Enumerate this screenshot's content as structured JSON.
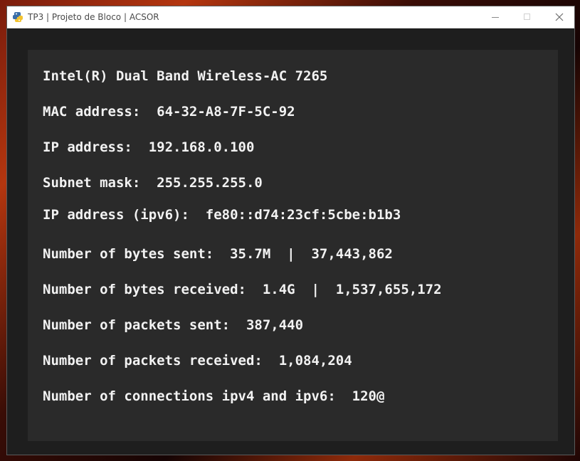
{
  "window": {
    "title": "TP3 | Projeto de Bloco | ACSOR",
    "icons": {
      "app": "python-snake-icon",
      "minimize": "minimize-icon",
      "maximize": "maximize-icon",
      "close": "close-icon"
    }
  },
  "network_info": {
    "adapter_name": "Intel(R) Dual Band Wireless-AC 7265",
    "mac_address": "MAC address:  64-32-A8-7F-5C-92",
    "ip_address": "IP address:  192.168.0.100",
    "subnet_mask": "Subnet mask:  255.255.255.0",
    "ipv6_address": "IP address (ipv6):  fe80::d74:23cf:5cbe:b1b3",
    "bytes_sent": "Number of bytes sent:  35.7M  |  37,443,862",
    "bytes_received": "Number of bytes received:  1.4G  |  1,537,655,172",
    "packets_sent": "Number of packets sent:  387,440",
    "packets_received": "Number of packets received:  1,084,204",
    "connections": "Number of connections ipv4 and ipv6:  120@"
  }
}
